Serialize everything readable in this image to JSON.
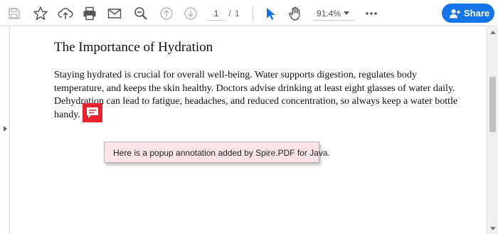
{
  "toolbar": {
    "icons": [
      "save-icon",
      "bookmark-star-icon",
      "upload-cloud-icon",
      "print-icon",
      "email-icon",
      "zoom-search-icon",
      "previous-page-icon",
      "next-page-icon",
      "select-cursor-icon",
      "hand-tool-icon",
      "more-options-icon"
    ],
    "page_current": "1",
    "page_separator": "/",
    "page_total": "1",
    "zoom_level": "91.4%",
    "share_label": "Share",
    "accent_color": "#1473e6"
  },
  "document": {
    "title": "The Importance of Hydration",
    "body_lines": [
      "Staying hydrated is crucial for overall well-being. Water supports digestion, regulates body",
      "temperature, and keeps the skin healthy. Doctors advise drinking at least eight glasses of water daily.",
      "Dehydration can lead to fatigue, headaches, and reduced concentration, so always keep a water bottle",
      "handy."
    ]
  },
  "annotation": {
    "icon": "comment-note-icon",
    "icon_color": "#e8232f",
    "popup_text": "Here is a popup annotation added by Spire.PDF for Java.",
    "popup_color": "#fbe4e7"
  }
}
